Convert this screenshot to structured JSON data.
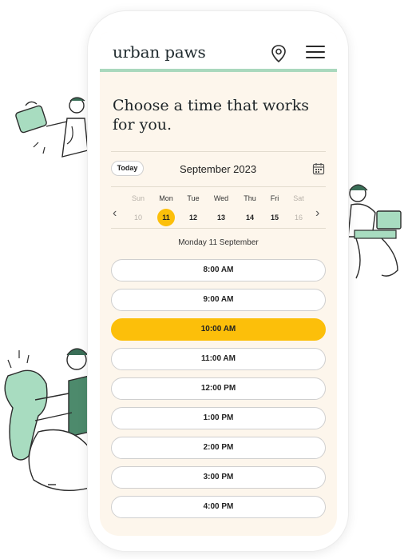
{
  "app": {
    "brand": "urban paws"
  },
  "header": {
    "icons": [
      "location-pin-icon",
      "hamburger-menu-icon"
    ]
  },
  "main": {
    "heading": "Choose a time that works for you."
  },
  "calendar": {
    "today_label": "Today",
    "month_label": "September 2023",
    "days": [
      {
        "dow": "Sun",
        "num": "10",
        "state": "muted"
      },
      {
        "dow": "Mon",
        "num": "11",
        "state": "selected"
      },
      {
        "dow": "Tue",
        "num": "12",
        "state": "normal"
      },
      {
        "dow": "Wed",
        "num": "13",
        "state": "normal"
      },
      {
        "dow": "Thu",
        "num": "14",
        "state": "normal"
      },
      {
        "dow": "Fri",
        "num": "15",
        "state": "normal"
      },
      {
        "dow": "Sat",
        "num": "16",
        "state": "muted"
      }
    ],
    "selected_date_label": "Monday 11 September",
    "nav": {
      "prev": "‹",
      "next": "›"
    }
  },
  "timeslots": [
    {
      "label": "8:00 AM"
    },
    {
      "label": "9:00 AM"
    },
    {
      "label": "10:00 AM",
      "selected": true
    },
    {
      "label": "11:00 AM"
    },
    {
      "label": "12:00 PM"
    },
    {
      "label": "1:00 PM"
    },
    {
      "label": "2:00 PM"
    },
    {
      "label": "3:00 PM"
    },
    {
      "label": "4:00 PM"
    }
  ],
  "colors": {
    "accent": "#fcbf0a",
    "header_border": "#a9d8bd",
    "screen_bg": "#fdf6ec",
    "illustration_green": "#a8dcc0"
  }
}
